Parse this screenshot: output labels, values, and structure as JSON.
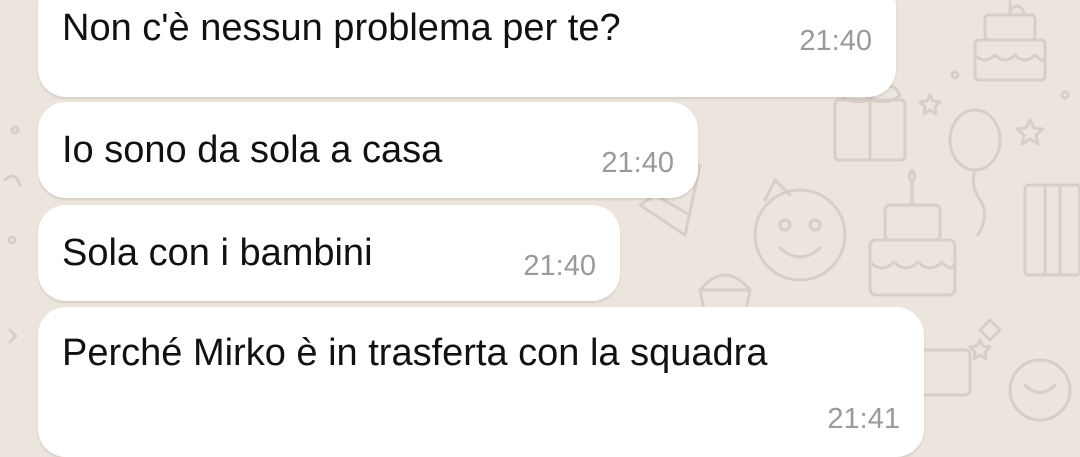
{
  "theme": {
    "chat_background": "#ece5dd",
    "bubble_color": "#ffffff",
    "text_color": "#111111",
    "timestamp_color": "#9a9a9a",
    "doodle_color": "#d6cfc6"
  },
  "messages": [
    {
      "text": "Non c'è nessun problema per te?",
      "time": "21:40"
    },
    {
      "text": "Io sono da sola a casa",
      "time": "21:40"
    },
    {
      "text": "Sola con i bambini",
      "time": "21:40"
    },
    {
      "text": "Perché Mirko è in trasferta con la squadra",
      "time": "21:41"
    }
  ]
}
